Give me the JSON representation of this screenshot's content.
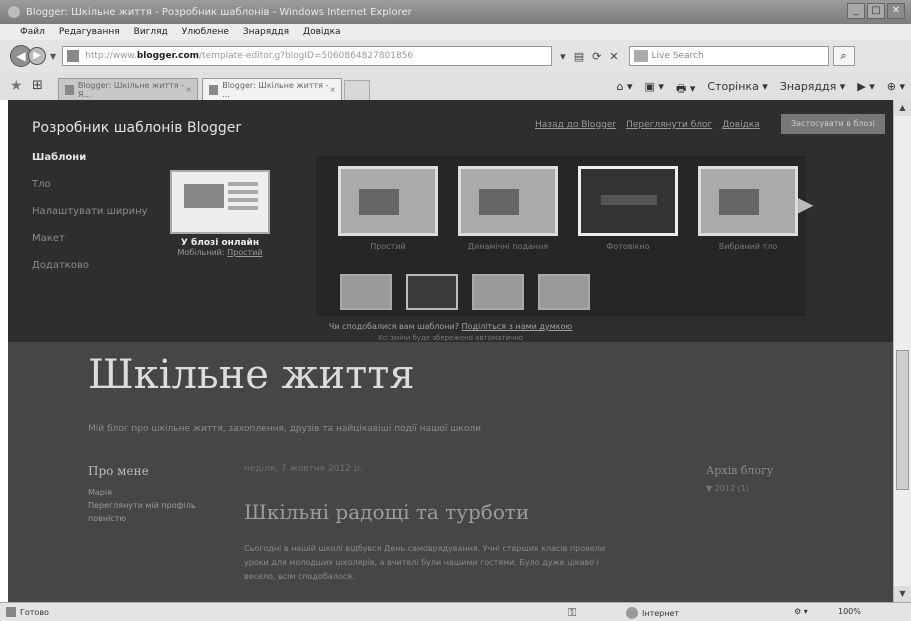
{
  "window": {
    "title": "Blogger: Шкільне життя - Розробник шаблонів - Windows Internet Explorer",
    "minimize": "_",
    "maximize": "□",
    "close": "✕"
  },
  "menubar": [
    "Файл",
    "Редагування",
    "Вигляд",
    "Улюблене",
    "Знаряддя",
    "Довідка"
  ],
  "address": {
    "prefix": "http://www.",
    "domain": "blogger.com",
    "rest": "/template-editor.g?blogID=5060864827801856"
  },
  "search": {
    "placeholder": "Live Search"
  },
  "tabs": [
    {
      "label": "Blogger: Шкільне життя - Я..."
    },
    {
      "label": "Blogger: Шкільне життя - ..."
    }
  ],
  "commandbar": [
    "⌂ ▾",
    "▣ ▾",
    "🖶 ▾",
    "Сторінка ▾",
    "Знаряддя ▾",
    "▶ ▾",
    "⊕ ▾"
  ],
  "designer": {
    "title": "Розробник шаблонів Blogger",
    "links": [
      "Назад до Blogger",
      "Переглянути блог",
      "Довідка"
    ],
    "apply": "Застосувати в блозі",
    "menu": [
      "Шаблони",
      "Тло",
      "Налаштувати ширину",
      "Макет",
      "Додатково"
    ],
    "current": {
      "label": "У блозі онлайн",
      "sub_prefix": "Мобільний:",
      "sub_link": "Простий"
    },
    "templates": [
      {
        "caption": "Простий"
      },
      {
        "caption": "Динамічні подання"
      },
      {
        "caption": "Фотовікно"
      },
      {
        "caption": "Вибраний тло"
      }
    ],
    "note_prefix": "Чи сподобалися вам шаблони?",
    "note_link": "Поділіться з нами думкою",
    "note2": "Усі зміни буде збережено автоматично"
  },
  "blog": {
    "title": "Шкільне життя",
    "description": "Мій блог про шкільне життя, захоплення, друзів та найцікавіші події нашої школи",
    "about_title": "Про мене",
    "about_links": [
      "Марія",
      "Переглянути мій профіль",
      "повністю"
    ],
    "post_date": "неділя, 7 жовтня 2012 р.",
    "post_title": "Шкільні радощі та турботи",
    "post_body": "Сьогодні в нашій школі відбувся День самоврядування. Учні старших класів провели уроки для молодших школярів, а вчителі були нашими гостями. Було дуже цікаво і весело, всім сподобалося.",
    "archive_title": "Архів блогу",
    "archive_item": "▼ 2012 (1)"
  },
  "status": {
    "text": "Готово",
    "zone": "Інтернет",
    "protect": "⚙ ▾",
    "zoom": "100%"
  }
}
